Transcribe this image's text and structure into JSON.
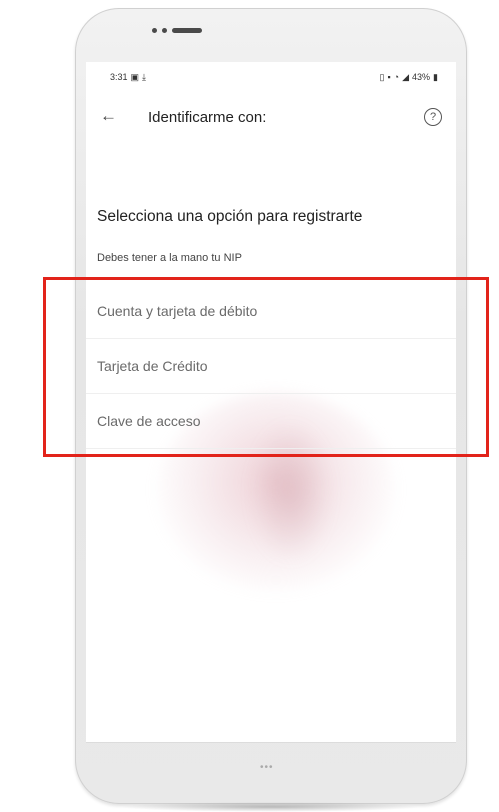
{
  "status_bar": {
    "time": "3:31",
    "battery": "43%"
  },
  "app_bar": {
    "title": "Identificarme con:"
  },
  "content": {
    "heading": "Selecciona una opción para registrarte",
    "subheading": "Debes tener a la mano tu NIP",
    "options": [
      {
        "label": "Cuenta y tarjeta de débito"
      },
      {
        "label": "Tarjeta de Crédito"
      },
      {
        "label": "Clave de acceso"
      }
    ]
  },
  "icons": {
    "back": "arrow-left-icon",
    "help": "question-circle-icon",
    "highlight_color": "#e2231a"
  }
}
